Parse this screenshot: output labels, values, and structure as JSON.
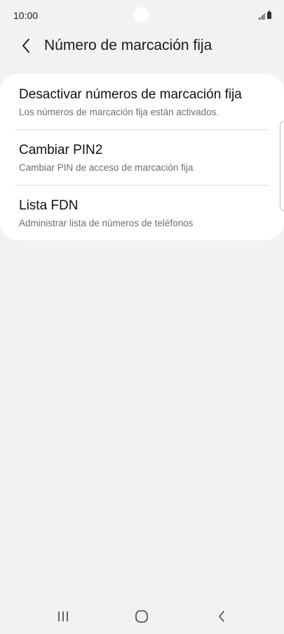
{
  "status_bar": {
    "time": "10:00",
    "signal_icon": "signal-icon",
    "battery_icon": "battery-icon"
  },
  "header": {
    "back_icon": "chevron-left-icon",
    "title": "Número de marcación fija"
  },
  "settings": {
    "items": [
      {
        "title": "Desactivar números de marcación fija",
        "subtitle": "Los números de marcación fija están activados."
      },
      {
        "title": "Cambiar PIN2",
        "subtitle": "Cambiar PIN de acceso de marcación fija"
      },
      {
        "title": "Lista FDN",
        "subtitle": "Administrar lista de números de teléfonos"
      }
    ]
  },
  "nav_bar": {
    "recents_icon": "recents-icon",
    "home_icon": "home-icon",
    "back_icon": "back-icon"
  },
  "colors": {
    "background": "#f2f2f2",
    "card": "#ffffff",
    "subtitle": "#6e6e6e"
  }
}
